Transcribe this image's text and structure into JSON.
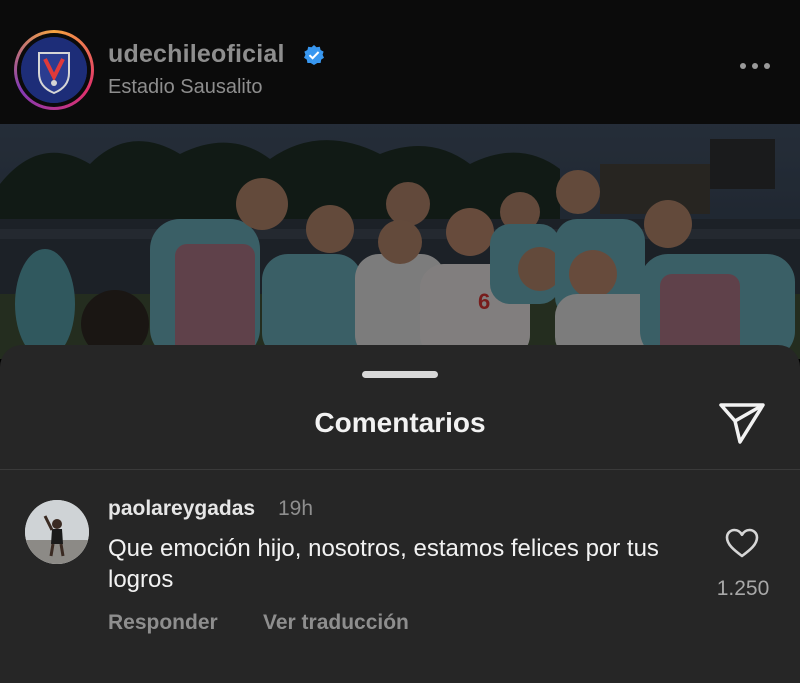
{
  "post_header": {
    "username": "udechileoficial",
    "location": "Estadio Sausalito",
    "verified_icon": "verified-badge-icon",
    "more_icon": "more-options-icon",
    "verified_color": "#3897f0"
  },
  "post_image": {
    "subject": "team-celebration-photo"
  },
  "comments_sheet": {
    "title": "Comentarios",
    "share_icon": "send-icon",
    "background": "#262626"
  },
  "comments": [
    {
      "username": "paolareygadas",
      "time": "19h",
      "text": "Que emoción hijo, nosotros, estamos felices por tus logros",
      "reply_label": "Responder",
      "translate_label": "Ver traducción",
      "like_count": "1.250",
      "like_icon": "heart-icon"
    }
  ]
}
